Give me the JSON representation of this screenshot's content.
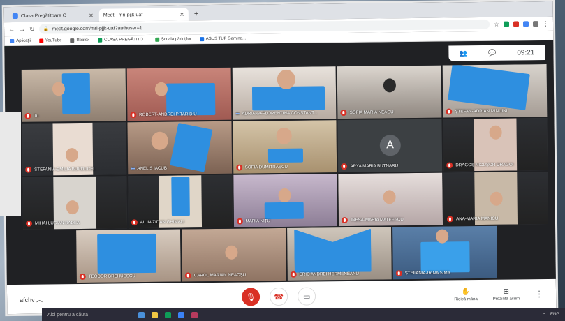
{
  "browser": {
    "tabs": [
      {
        "title": "Clasa Pregătitoare C",
        "active": false
      },
      {
        "title": "Meet - mri-pjjk-uaf",
        "active": true
      }
    ],
    "url": "meet.google.com/mri-pjjk-uaf?authuser=1",
    "bookmarks": [
      "Aplicații",
      "YouTube",
      "Roblox",
      "CLASA PREGĂTITO...",
      "Școala părinților",
      "ASUS TUF Gaming..."
    ]
  },
  "meet": {
    "clock": "09:21",
    "participant_count_icon": "people-icon",
    "meeting_code": "afchv",
    "raise_hand": "Ridică mâna",
    "present_now": "Prezintă acum",
    "tiles": [
      [
        "Tu",
        "ROBERT-ANDREI PITARIDIU",
        "ADRIANA-FLORENTINA CONSTANT...",
        "SOFIA MARIA NEAGU",
        "ȘTEFAN-ADRIAN MINUINI"
      ],
      [
        "ȘTEFANIA-EMILIA BURDUCEL",
        "ANELIS IACUB",
        "SOFIA DUMITRAȘCU",
        "ARYA MARIA BUTNARU",
        "DRAGOȘ NICUȘOR DRAGOI"
      ],
      [
        "MIHAI LUCIAN BADEA",
        "AILIN-ZIDAN GHIMALI",
        "MARIA NIȚU",
        "INESA-MARIA MATEESCU",
        "ANA-MARIA MANICU"
      ],
      [
        "TEODOR BREHUESCU",
        "CAROL MARIAN NEACȘU",
        "ERIC ANDREI HERMENEANU",
        "ȘTEFANIA-IRINA SIMA"
      ]
    ],
    "avatar_letter": "A"
  },
  "taskbar": {
    "search": "Aici pentru a căuta",
    "lang": "ENG"
  },
  "colors": {
    "meet_bg": "#202124",
    "mic_off": "#d93025",
    "paper_blue": "#2e8fe0"
  }
}
